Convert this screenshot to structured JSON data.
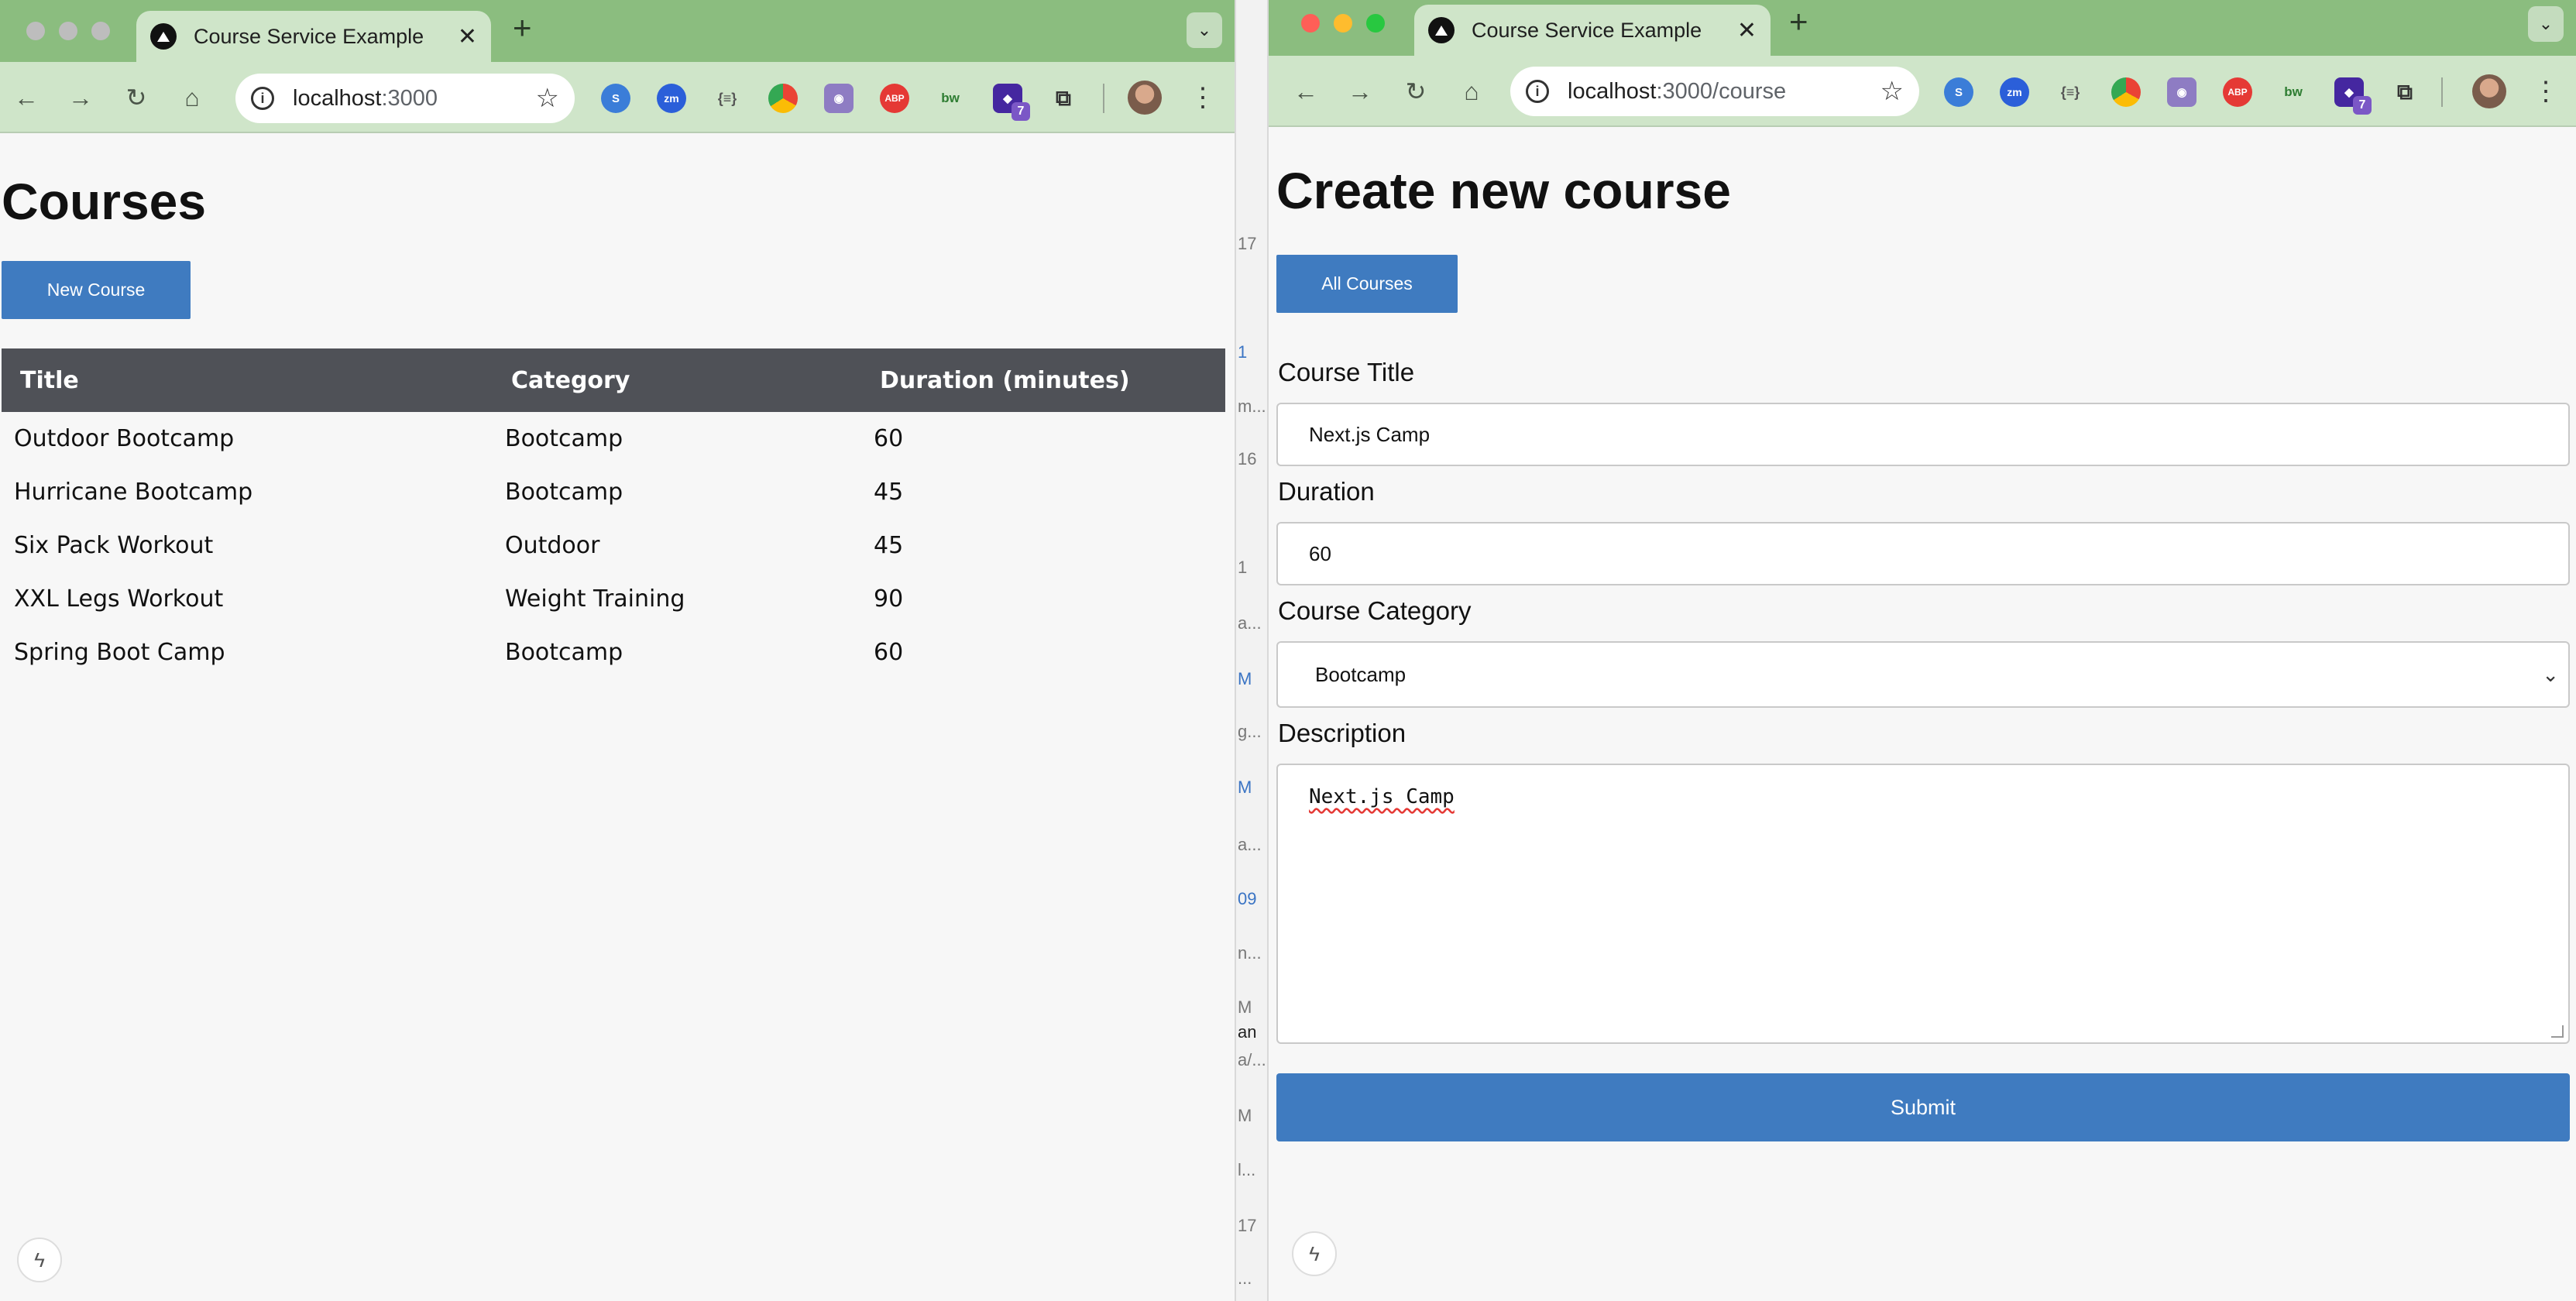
{
  "left_window": {
    "tab_title": "Course Service Example",
    "url_host": "localhost",
    "url_port": ":3000",
    "ext_badge": "7",
    "page_title": "Courses",
    "new_course_label": "New Course",
    "table": {
      "headers": [
        "Title",
        "Category",
        "Duration (minutes)"
      ],
      "rows": [
        [
          "Outdoor Bootcamp",
          "Bootcamp",
          "60"
        ],
        [
          "Hurricane Bootcamp",
          "Bootcamp",
          "45"
        ],
        [
          "Six Pack Workout",
          "Outdoor",
          "45"
        ],
        [
          "XXL Legs Workout",
          "Weight Training",
          "90"
        ],
        [
          "Spring Boot Camp",
          "Bootcamp",
          "60"
        ]
      ]
    }
  },
  "right_window": {
    "tab_title": "Course Service Example",
    "url_host": "localhost",
    "url_path": ":3000/course",
    "ext_badge": "7",
    "page_title": "Create new course",
    "all_courses_label": "All Courses",
    "form": {
      "title_label": "Course Title",
      "title_value": "Next.js Camp",
      "duration_label": "Duration",
      "duration_value": "60",
      "category_label": "Course Category",
      "category_value": "Bootcamp",
      "description_label": "Description",
      "description_value": "Next.js Camp",
      "submit_label": "Submit"
    }
  },
  "background_strip": [
    "17",
    "1",
    "m...",
    "16",
    "1",
    "a...",
    "M",
    "g...",
    "M",
    "a...",
    "09",
    "n...",
    "M",
    "an",
    "a/...",
    "M",
    "l...",
    "17",
    "..."
  ],
  "colors": {
    "tab_bar": "#8bbd7f",
    "toolbar": "#cfe5c9",
    "accent_button": "#3f7bc0",
    "table_header": "#4f5157"
  }
}
